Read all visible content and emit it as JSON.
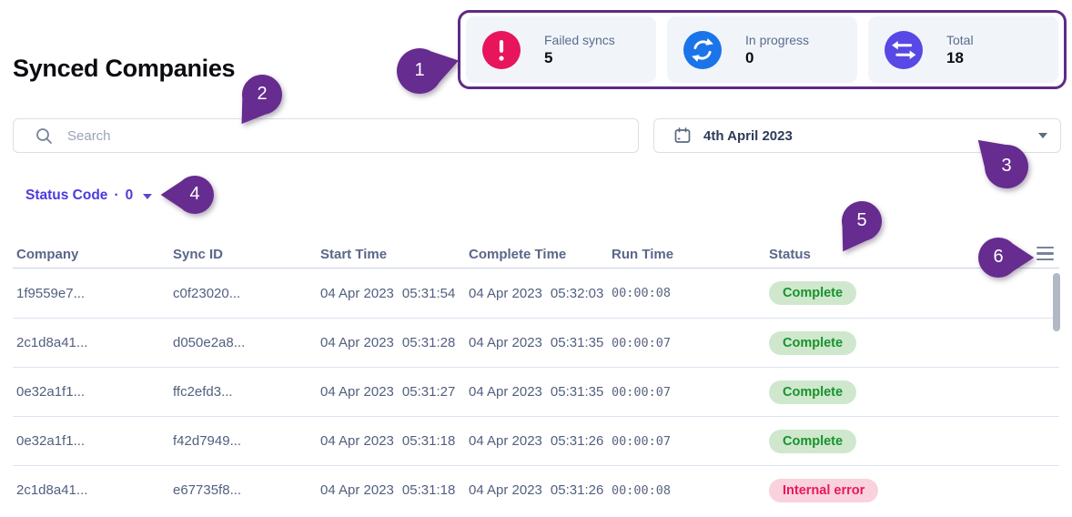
{
  "page": {
    "title": "Synced Companies"
  },
  "stats": [
    {
      "label": "Failed syncs",
      "value": "5",
      "icon": "alert-icon",
      "icon_color": "#e8145c"
    },
    {
      "label": "In progress",
      "value": "0",
      "icon": "sync-icon",
      "icon_color": "#1b74e8"
    },
    {
      "label": "Total",
      "value": "18",
      "icon": "transfer-icon",
      "icon_color": "#5848e5"
    }
  ],
  "search": {
    "placeholder": "Search"
  },
  "date_picker": {
    "value": "4th April 2023"
  },
  "filter": {
    "label": "Status Code",
    "separator": "·",
    "count": "0"
  },
  "table": {
    "columns": [
      "Company",
      "Sync ID",
      "Start Time",
      "Complete Time",
      "Run Time",
      "Status"
    ],
    "rows": [
      {
        "company": "1f9559e7...",
        "sync_id": "c0f23020...",
        "start_date": "04 Apr 2023",
        "start_time": "05:31:54",
        "complete_date": "04 Apr 2023",
        "complete_time": "05:32:03",
        "run_time": "00:00:08",
        "status": "Complete",
        "status_type": "success"
      },
      {
        "company": "2c1d8a41...",
        "sync_id": "d050e2a8...",
        "start_date": "04 Apr 2023",
        "start_time": "05:31:28",
        "complete_date": "04 Apr 2023",
        "complete_time": "05:31:35",
        "run_time": "00:00:07",
        "status": "Complete",
        "status_type": "success"
      },
      {
        "company": "0e32a1f1...",
        "sync_id": "ffc2efd3...",
        "start_date": "04 Apr 2023",
        "start_time": "05:31:27",
        "complete_date": "04 Apr 2023",
        "complete_time": "05:31:35",
        "run_time": "00:00:07",
        "status": "Complete",
        "status_type": "success"
      },
      {
        "company": "0e32a1f1...",
        "sync_id": "f42d7949...",
        "start_date": "04 Apr 2023",
        "start_time": "05:31:18",
        "complete_date": "04 Apr 2023",
        "complete_time": "05:31:26",
        "run_time": "00:00:07",
        "status": "Complete",
        "status_type": "success"
      },
      {
        "company": "2c1d8a41...",
        "sync_id": "e67735f8...",
        "start_date": "04 Apr 2023",
        "start_time": "05:31:18",
        "complete_date": "04 Apr 2023",
        "complete_time": "05:31:26",
        "run_time": "00:00:08",
        "status": "Internal error",
        "status_type": "error"
      }
    ]
  },
  "annotations": {
    "callouts": [
      "1",
      "2",
      "3",
      "4",
      "5",
      "6"
    ]
  },
  "colors": {
    "annotation_purple": "#662c8f",
    "failed_icon": "#e8145c",
    "progress_icon": "#1b74e8",
    "total_icon": "#5848e5",
    "success_bg": "#cfe8cd",
    "success_text": "#17922c",
    "error_bg": "#f9d2de",
    "error_text": "#ea175d",
    "accent_link": "#4a3be0"
  }
}
